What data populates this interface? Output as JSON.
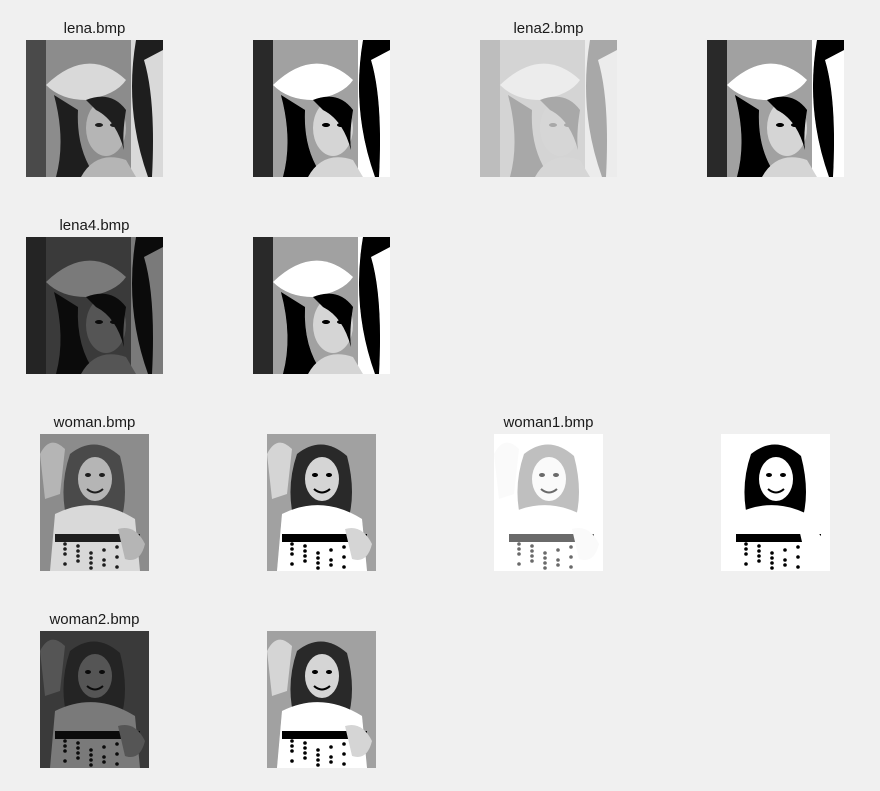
{
  "figure": {
    "background": "#f0f0f0",
    "rows": [
      {
        "panels": [
          {
            "title": "lena.bmp",
            "subject": "lena",
            "tone": "original"
          },
          {
            "title": "",
            "subject": "lena",
            "tone": "equalized"
          },
          {
            "title": "lena2.bmp",
            "subject": "lena",
            "tone": "bright-low-contrast"
          },
          {
            "title": "",
            "subject": "lena",
            "tone": "equalized"
          }
        ]
      },
      {
        "panels": [
          {
            "title": "lena4.bmp",
            "subject": "lena",
            "tone": "dark"
          },
          {
            "title": "",
            "subject": "lena",
            "tone": "equalized"
          }
        ]
      },
      {
        "panels": [
          {
            "title": "woman.bmp",
            "subject": "woman",
            "tone": "original"
          },
          {
            "title": "",
            "subject": "woman",
            "tone": "equalized"
          },
          {
            "title": "woman1.bmp",
            "subject": "woman",
            "tone": "very-bright"
          },
          {
            "title": "",
            "subject": "woman",
            "tone": "thresholded"
          }
        ]
      },
      {
        "panels": [
          {
            "title": "woman2.bmp",
            "subject": "woman",
            "tone": "dark"
          },
          {
            "title": "",
            "subject": "woman",
            "tone": "equalized"
          }
        ]
      }
    ]
  }
}
